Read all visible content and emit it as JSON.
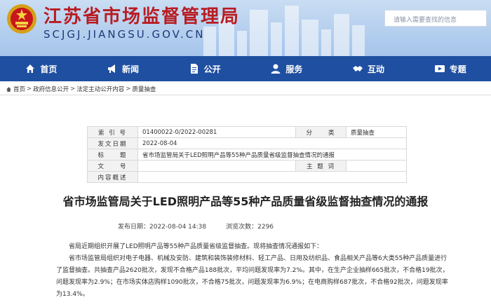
{
  "header": {
    "site_title": "江苏省市场监督管理局",
    "site_domain": "SCJGJ.JIANGSU.GOV.CN",
    "search_placeholder": "请输入需要查找的信息"
  },
  "nav": [
    {
      "label": "首页",
      "icon": "home-icon"
    },
    {
      "label": "新闻",
      "icon": "megaphone-icon"
    },
    {
      "label": "公开",
      "icon": "document-icon"
    },
    {
      "label": "服务",
      "icon": "service-icon"
    },
    {
      "label": "互动",
      "icon": "handshake-icon"
    },
    {
      "label": "专题",
      "icon": "video-icon"
    }
  ],
  "breadcrumb": [
    "首页",
    "政府信息公开",
    "法定主动公开内容",
    "质量抽查"
  ],
  "meta": {
    "index_label": "索 引 号",
    "index_value": "01400022-0/2022-00281",
    "category_label": "分　　类",
    "category_value": "质量抽查",
    "date_label": "发文日期",
    "date_value": "2022-08-04",
    "subject_label": "标　　题",
    "subject_value": "省市场监管局关于LED照明产品等55种产品质量省级监督抽查情况的通报",
    "docno_label": "文　　号",
    "docno_value": "",
    "keywords_label": "主 题 词",
    "keywords_value": "",
    "summary_label": "内容概述",
    "summary_value": ""
  },
  "article": {
    "title": "省市场监管局关于LED照明产品等55种产品质量省级监督抽查情况的通报",
    "published": "发布日期：2022-08-04 14:38",
    "views_label": "浏览次数：",
    "views": "2296",
    "para1": "省局近期组织开展了LED照明产品等55种产品质量省级监督抽查。现将抽查情况通报如下：",
    "para2": "省市场监管局组织对电子电器、机械及安防、建筑和装饰装修材料、轻工产品、日用及纺织品、食品相关产品等6大类55种产品质量进行了监督抽查。共抽查产品2620批次，发现不合格产品188批次，平均问题发现率为7.2%。其中，在生产企业抽样665批次，不合格19批次，问题发现率为2.9%；在市场实体店购样1090批次，不合格75批次，问题发现率为6.9%；在电商购样687批次，不合格92批次，问题发现率为13.4%。"
  },
  "colors": {
    "nav_bg": "#1f4fa0",
    "title_red": "#b81c22",
    "domain_blue": "#1e3a78"
  }
}
